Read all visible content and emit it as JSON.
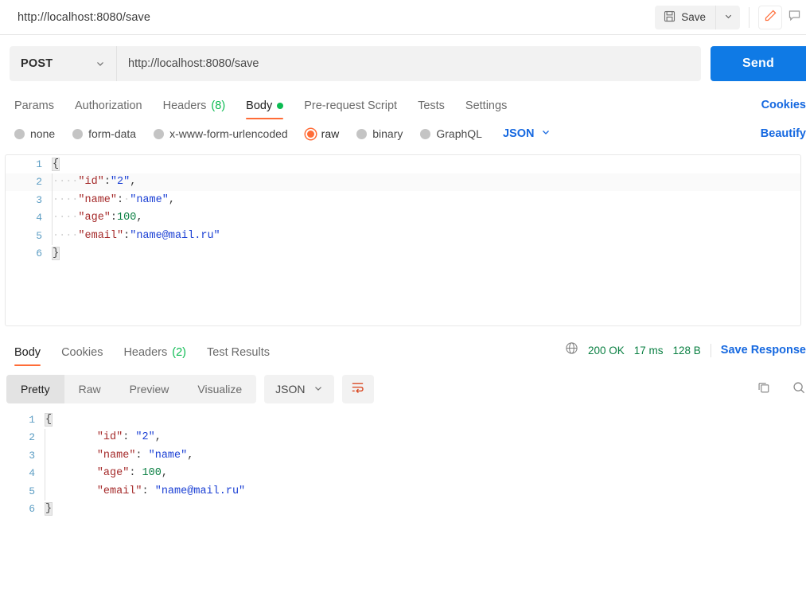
{
  "topbar": {
    "breadcrumb": "http://localhost:8080/save",
    "save_label": "Save",
    "save_icon": "floppy-disk-icon",
    "caret_icon": "chevron-down-icon",
    "edit_icon": "pencil-icon",
    "comment_icon": "comment-icon"
  },
  "request": {
    "method": "POST",
    "method_caret": "chevron-down-icon",
    "url": "http://localhost:8080/save",
    "send_label": "Send",
    "tabs": [
      {
        "label": "Params",
        "count": "",
        "active": false,
        "dot": false
      },
      {
        "label": "Authorization",
        "count": "",
        "active": false,
        "dot": false
      },
      {
        "label": "Headers",
        "count": "(8)",
        "active": false,
        "dot": false
      },
      {
        "label": "Body",
        "count": "",
        "active": true,
        "dot": true
      },
      {
        "label": "Pre-request Script",
        "count": "",
        "active": false,
        "dot": false
      },
      {
        "label": "Tests",
        "count": "",
        "active": false,
        "dot": false
      },
      {
        "label": "Settings",
        "count": "",
        "active": false,
        "dot": false
      }
    ],
    "cookies_link": "Cookies",
    "beautify_link": "Beautify",
    "body_types": [
      {
        "label": "none",
        "selected": false
      },
      {
        "label": "form-data",
        "selected": false
      },
      {
        "label": "x-www-form-urlencoded",
        "selected": false
      },
      {
        "label": "raw",
        "selected": true
      },
      {
        "label": "binary",
        "selected": false
      },
      {
        "label": "GraphQL",
        "selected": false
      }
    ],
    "format": "JSON",
    "format_caret": "chevron-down-icon",
    "body_lines": [
      {
        "n": "1",
        "indent": 0,
        "tokens": [
          {
            "t": "brace",
            "v": "{"
          }
        ]
      },
      {
        "n": "2",
        "indent": 1,
        "tokens": [
          {
            "t": "key",
            "v": "\"id\""
          },
          {
            "t": "punc",
            "v": ":"
          },
          {
            "t": "str",
            "v": "\"2\""
          },
          {
            "t": "punc",
            "v": ","
          }
        ]
      },
      {
        "n": "3",
        "indent": 1,
        "tokens": [
          {
            "t": "key",
            "v": "\"name\""
          },
          {
            "t": "punc",
            "v": ":"
          },
          {
            "t": "ws",
            "v": "·"
          },
          {
            "t": "str",
            "v": "\"name\""
          },
          {
            "t": "punc",
            "v": ","
          }
        ]
      },
      {
        "n": "4",
        "indent": 1,
        "tokens": [
          {
            "t": "key",
            "v": "\"age\""
          },
          {
            "t": "punc",
            "v": ":"
          },
          {
            "t": "num",
            "v": "100"
          },
          {
            "t": "punc",
            "v": ","
          }
        ]
      },
      {
        "n": "5",
        "indent": 1,
        "tokens": [
          {
            "t": "key",
            "v": "\"email\""
          },
          {
            "t": "punc",
            "v": ":"
          },
          {
            "t": "str",
            "v": "\"name@mail.ru\""
          }
        ]
      },
      {
        "n": "6",
        "indent": 0,
        "tokens": [
          {
            "t": "brace",
            "v": "}"
          }
        ]
      }
    ]
  },
  "response": {
    "tabs": [
      {
        "label": "Body",
        "count": "",
        "active": true
      },
      {
        "label": "Cookies",
        "count": "",
        "active": false
      },
      {
        "label": "Headers",
        "count": "(2)",
        "active": false
      },
      {
        "label": "Test Results",
        "count": "",
        "active": false
      }
    ],
    "globe_icon": "globe-icon",
    "status": "200 OK",
    "time": "17 ms",
    "size": "128 B",
    "save_response_label": "Save Response",
    "view_modes": [
      {
        "label": "Pretty",
        "active": true
      },
      {
        "label": "Raw",
        "active": false
      },
      {
        "label": "Preview",
        "active": false
      },
      {
        "label": "Visualize",
        "active": false
      }
    ],
    "format": "JSON",
    "format_caret": "chevron-down-icon",
    "wrap_icon": "word-wrap-icon",
    "copy_icon": "copy-icon",
    "search_icon": "search-icon",
    "body_lines": [
      {
        "n": "1",
        "indent": 0,
        "tokens": [
          {
            "t": "brace",
            "v": "{"
          }
        ]
      },
      {
        "n": "2",
        "indent": 1,
        "tokens": [
          {
            "t": "key",
            "v": "\"id\""
          },
          {
            "t": "punc",
            "v": ": "
          },
          {
            "t": "str",
            "v": "\"2\""
          },
          {
            "t": "punc",
            "v": ","
          }
        ]
      },
      {
        "n": "3",
        "indent": 1,
        "tokens": [
          {
            "t": "key",
            "v": "\"name\""
          },
          {
            "t": "punc",
            "v": ": "
          },
          {
            "t": "str",
            "v": "\"name\""
          },
          {
            "t": "punc",
            "v": ","
          }
        ]
      },
      {
        "n": "4",
        "indent": 1,
        "tokens": [
          {
            "t": "key",
            "v": "\"age\""
          },
          {
            "t": "punc",
            "v": ": "
          },
          {
            "t": "num",
            "v": "100"
          },
          {
            "t": "punc",
            "v": ","
          }
        ]
      },
      {
        "n": "5",
        "indent": 1,
        "tokens": [
          {
            "t": "key",
            "v": "\"email\""
          },
          {
            "t": "punc",
            "v": ": "
          },
          {
            "t": "str",
            "v": "\"name@mail.ru\""
          }
        ]
      },
      {
        "n": "6",
        "indent": 0,
        "tokens": [
          {
            "t": "brace",
            "v": "}"
          }
        ]
      }
    ]
  },
  "colors": {
    "accent_orange": "#ff6c37",
    "link_blue": "#1568e0",
    "send_blue": "#0f7ae5",
    "status_green": "#0b8043",
    "dot_green": "#0cbb52"
  }
}
